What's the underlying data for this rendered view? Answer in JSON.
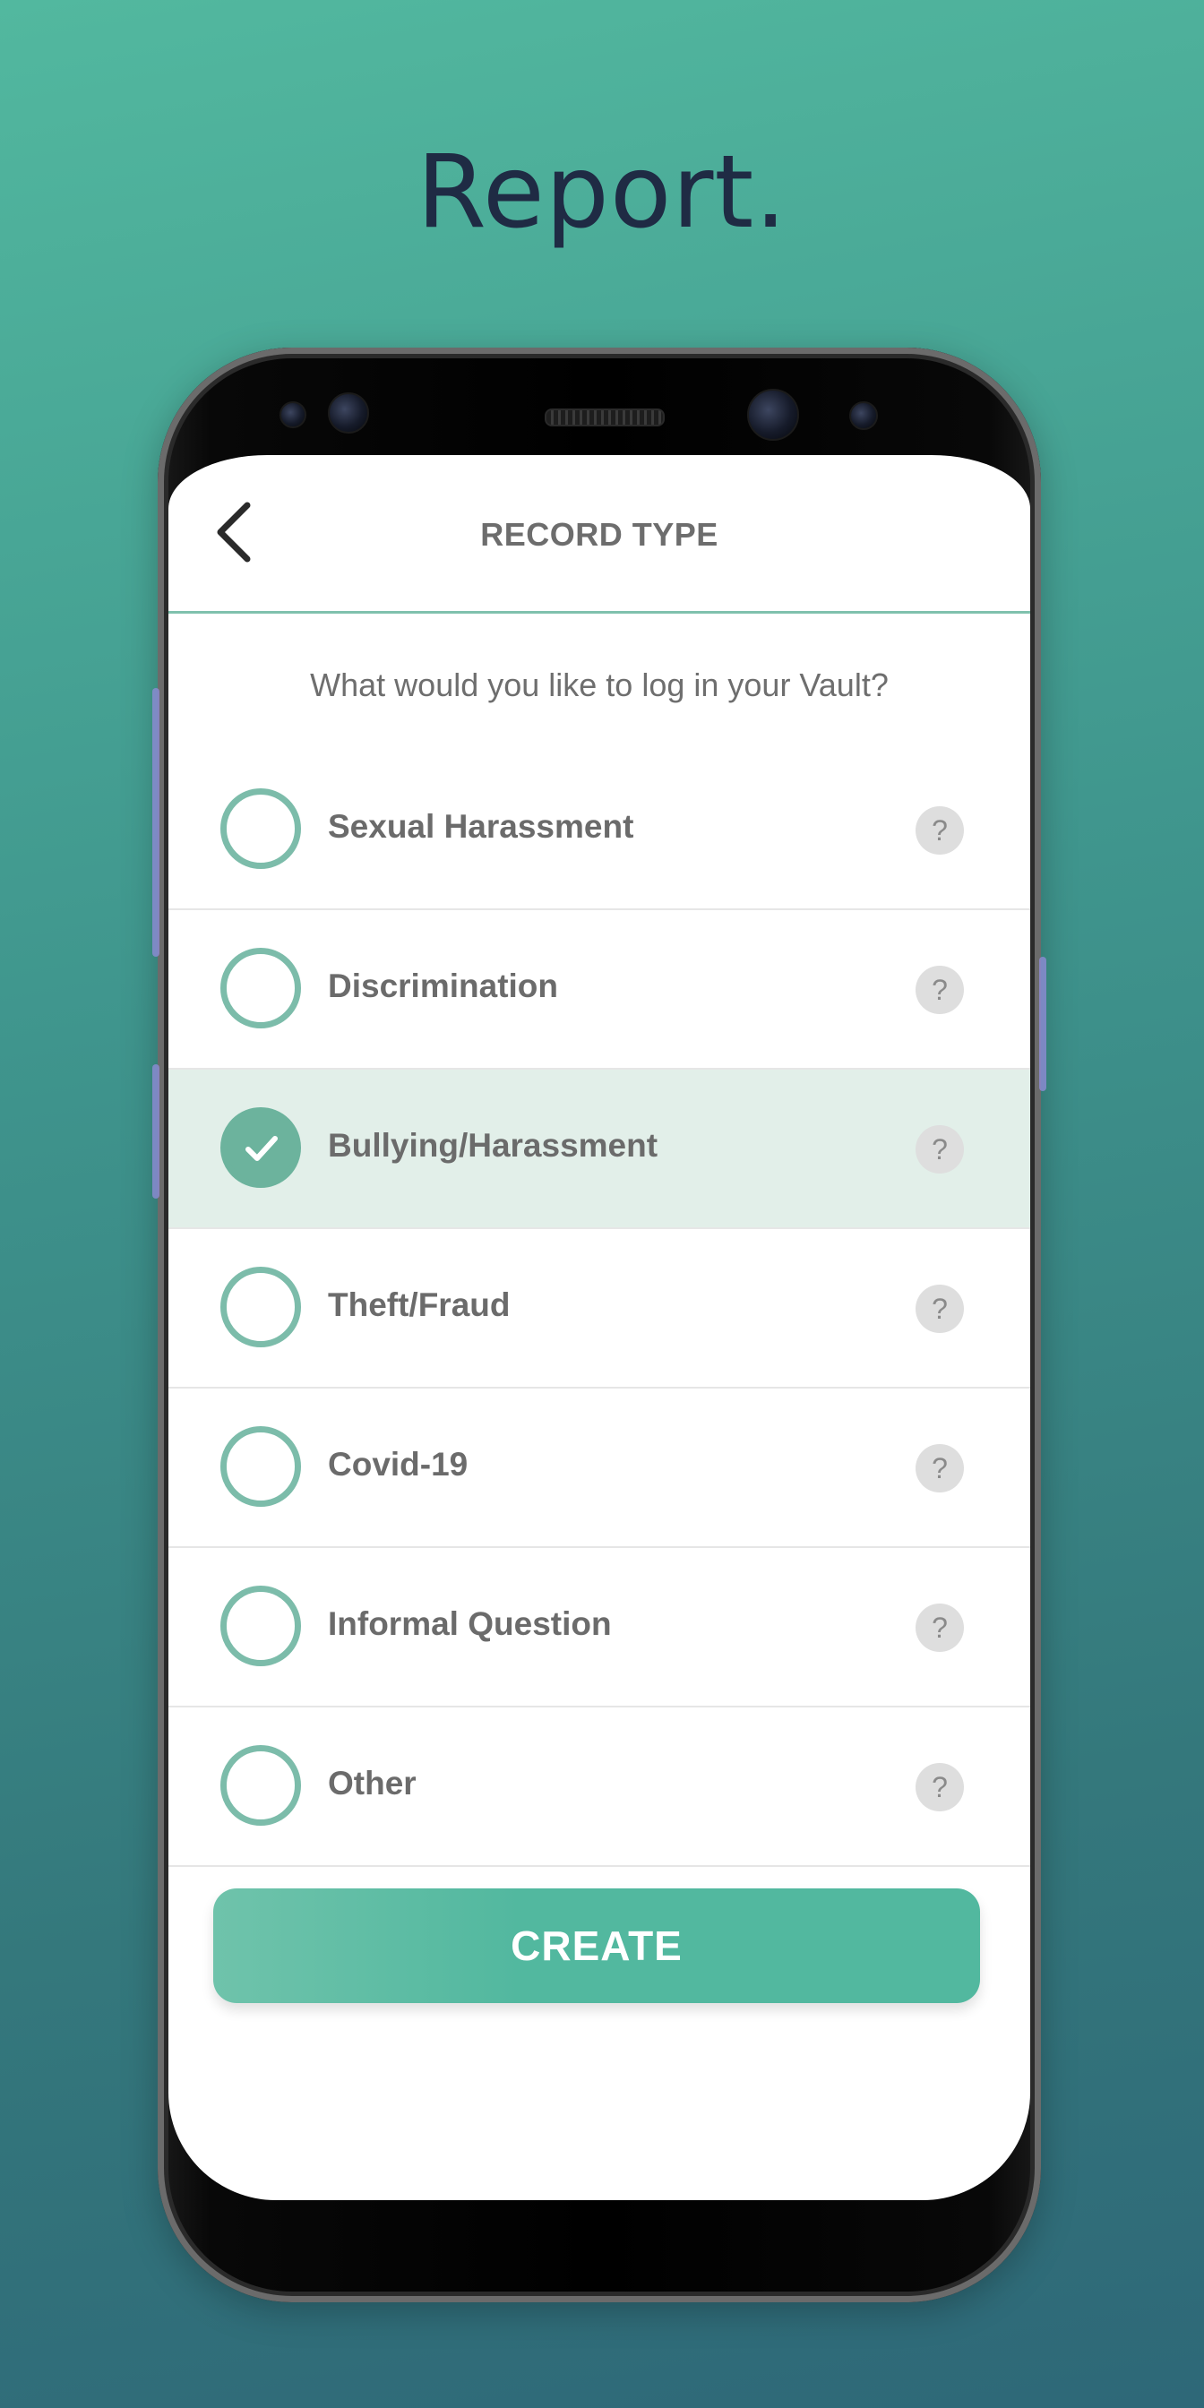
{
  "headline": "Report.",
  "header": {
    "title": "RECORD TYPE"
  },
  "prompt": "What would you like to log in your Vault?",
  "options": [
    {
      "label": "Sexual Harassment",
      "selected": false
    },
    {
      "label": "Discrimination",
      "selected": false
    },
    {
      "label": "Bullying/Harassment",
      "selected": true
    },
    {
      "label": "Theft/Fraud",
      "selected": false
    },
    {
      "label": "Covid-19",
      "selected": false
    },
    {
      "label": "Informal Question",
      "selected": false
    },
    {
      "label": "Other",
      "selected": false
    }
  ],
  "help_glyph": "?",
  "create_button": {
    "label": "CREATE"
  },
  "colors": {
    "accent": "#52b89f",
    "selected_row": "#e2efe9",
    "radio_border": "#7cbcaa",
    "headline": "#1f2b44"
  },
  "icons": {
    "back": "chevron-left-icon",
    "help": "question-mark-icon",
    "check": "checkmark-icon"
  }
}
